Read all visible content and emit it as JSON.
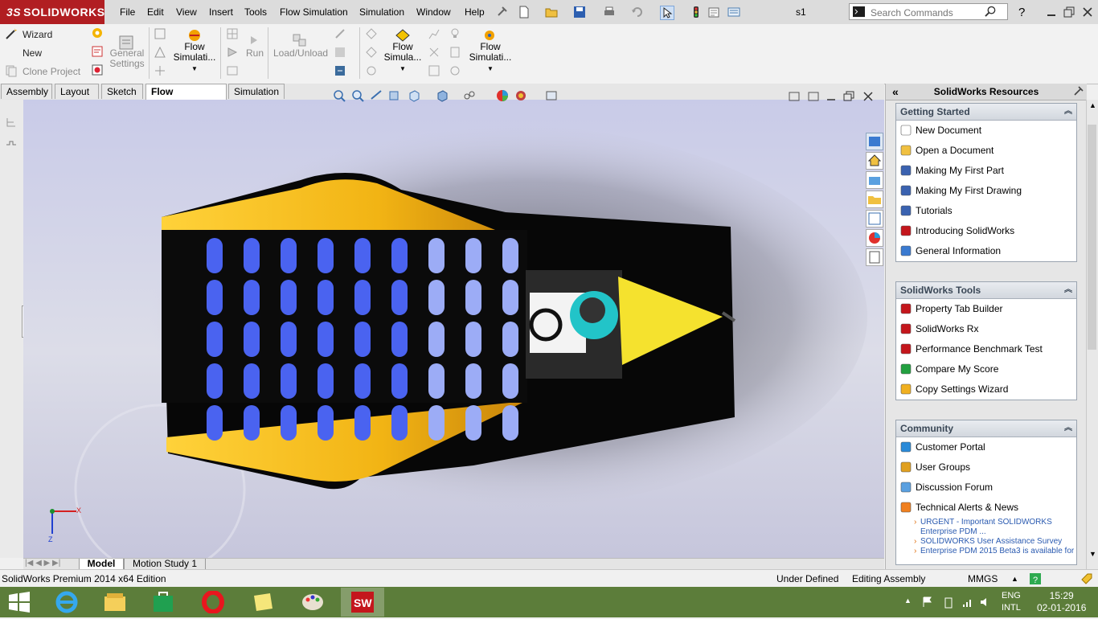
{
  "app": {
    "brand": "SOLIDWORKS",
    "brand_prefix": "3S",
    "document_name": "s1"
  },
  "menu": [
    "File",
    "Edit",
    "View",
    "Insert",
    "Tools",
    "Flow Simulation",
    "Simulation",
    "Window",
    "Help"
  ],
  "search": {
    "placeholder": "Search Commands"
  },
  "command_manager": {
    "wizard": "Wizard",
    "new": "New",
    "clone_project": "Clone Project",
    "general_settings": [
      "General",
      "Settings"
    ],
    "flow_simulation_1": [
      "Flow",
      "Simulati..."
    ],
    "run": "Run",
    "load_unload": "Load/Unload",
    "flow_simulation_2": [
      "Flow",
      "Simula..."
    ],
    "flow_simulation_3": [
      "Flow",
      "Simulati..."
    ]
  },
  "tabs": [
    {
      "label": "Assembly",
      "active": false
    },
    {
      "label": "Layout",
      "active": false
    },
    {
      "label": "Sketch",
      "active": false
    },
    {
      "label": "Flow Simulation",
      "active": true
    },
    {
      "label": "Simulation",
      "active": false
    }
  ],
  "task_pane": {
    "title": "SolidWorks Resources",
    "groups": [
      {
        "title": "Getting Started",
        "items": [
          {
            "label": "New Document",
            "icon": "document-icon"
          },
          {
            "label": "Open a Document",
            "icon": "folder-open-icon"
          },
          {
            "label": "Making My First Part",
            "icon": "graduation-cap-icon"
          },
          {
            "label": "Making My First Drawing",
            "icon": "graduation-cap-icon"
          },
          {
            "label": "Tutorials",
            "icon": "graduation-cap-icon"
          },
          {
            "label": "Introducing SolidWorks",
            "icon": "solidworks-icon"
          },
          {
            "label": "General Information",
            "icon": "info-icon"
          }
        ]
      },
      {
        "title": "SolidWorks Tools",
        "items": [
          {
            "label": "Property Tab Builder",
            "icon": "tool-icon"
          },
          {
            "label": "SolidWorks Rx",
            "icon": "tool-icon"
          },
          {
            "label": "Performance Benchmark Test",
            "icon": "tool-icon"
          },
          {
            "label": "Compare My Score",
            "icon": "refresh-icon"
          },
          {
            "label": "Copy Settings Wizard",
            "icon": "wizard-icon"
          }
        ]
      },
      {
        "title": "Community",
        "items": [
          {
            "label": "Customer Portal",
            "icon": "globe-icon"
          },
          {
            "label": "User Groups",
            "icon": "users-icon"
          },
          {
            "label": "Discussion Forum",
            "icon": "forum-icon"
          },
          {
            "label": "Technical Alerts & News",
            "icon": "rss-icon"
          }
        ],
        "news": [
          "URGENT - Important SOLIDWORKS Enterprise PDM ...",
          "SOLIDWORKS User Assistance Survey",
          "Enterprise PDM 2015 Beta3 is available for"
        ]
      }
    ]
  },
  "model_tabs": [
    {
      "label": "Model",
      "active": true
    },
    {
      "label": "Motion Study 1",
      "active": false
    }
  ],
  "status": {
    "edition": "SolidWorks Premium 2014 x64 Edition",
    "definition": "Under Defined",
    "mode": "Editing Assembly",
    "units": "MMGS"
  },
  "taskbar": {
    "lang_top": "ENG",
    "lang_bottom": "INTL",
    "time": "15:29",
    "date": "02-01-2016"
  },
  "colors": {
    "brand_red": "#b11e22",
    "taskbar_green": "#5c7d3a",
    "car_yellow": "#f5c21b",
    "window_blue": "#3c5ae8"
  }
}
